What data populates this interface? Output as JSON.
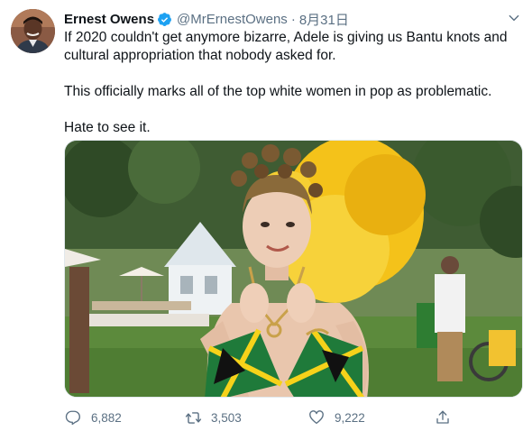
{
  "author": {
    "display_name": "Ernest Owens",
    "handle": "@MrErnestOwens",
    "separator": "·",
    "date": "8月31日"
  },
  "tweet": {
    "paragraphs": [
      "If 2020 couldn't get anymore bizarre, Adele is giving us Bantu knots and cultural appropriation that nobody asked for.",
      "This officially marks all of the top white women in pop as problematic.",
      "Hate to see it."
    ]
  },
  "actions": {
    "reply_count": "6,882",
    "retweet_count": "3,503",
    "like_count": "9,222"
  },
  "icons": {
    "verified": "verified-badge-icon",
    "caret": "chevron-down-icon",
    "reply": "reply-icon",
    "retweet": "retweet-icon",
    "like": "heart-icon",
    "share": "share-icon"
  },
  "colors": {
    "text_primary": "#0f1419",
    "text_secondary": "#5b7083",
    "verified_blue": "#1da1f2"
  }
}
